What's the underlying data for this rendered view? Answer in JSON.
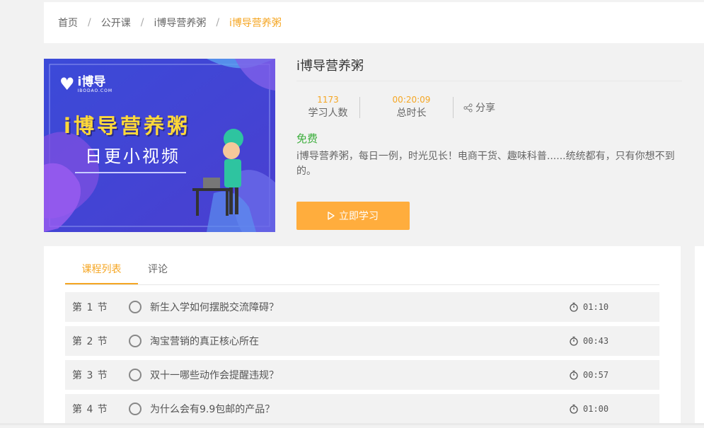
{
  "breadcrumb": {
    "items": [
      "首页",
      "公开课",
      "i博导营养粥"
    ],
    "current": "i博导营养粥",
    "separator": "/"
  },
  "banner": {
    "logo_text": "i博导",
    "logo_sub": "IBODAO.COM",
    "headline": "i博导营养粥",
    "subline": "日更小视频"
  },
  "course": {
    "title": "i博导营养粥",
    "stats": {
      "learners_value": "1173",
      "learners_label": "学习人数",
      "duration_value": "00:20:09",
      "duration_label": "总时长"
    },
    "share_label": "分享",
    "price": "免费",
    "description": "i博导营养粥，每日一例，时光见长！电商干货、趣味科普......统统都有，只有你想不到的。",
    "study_button": "立即学习"
  },
  "tabs": [
    {
      "label": "课程列表",
      "active": true
    },
    {
      "label": "评论",
      "active": false
    }
  ],
  "lessons": [
    {
      "index": "第 1 节",
      "title": "新生入学如何摆脱交流障碍？",
      "duration": "01:10"
    },
    {
      "index": "第 2 节",
      "title": "淘宝营销的真正核心所在",
      "duration": "00:43"
    },
    {
      "index": "第 3 节",
      "title": "双十一哪些动作会提醒违规？",
      "duration": "00:57"
    },
    {
      "index": "第 4 节",
      "title": "为什么会有9.9包邮的产品？",
      "duration": "01:00"
    }
  ],
  "colors": {
    "accent": "#f5a623",
    "button": "#ffad3d",
    "price": "#3cae3c",
    "banner_bg": "#3f4fd6"
  }
}
